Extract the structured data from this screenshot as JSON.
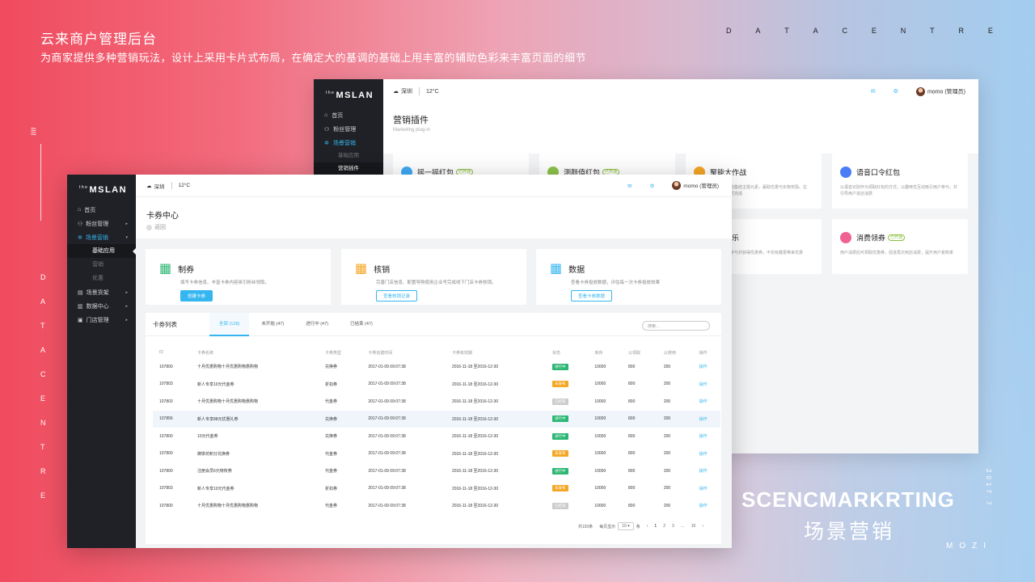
{
  "poster": {
    "title": "云来商户管理后台",
    "subtitle": "为商家提供多种营销玩法，设计上采用卡片式布局，在确定大的基调的基础上用丰富的辅助色彩来丰富页面的细节",
    "datacentre_letters": [
      "D",
      "A",
      "T",
      "A",
      "C",
      "E",
      "N",
      "T",
      "R",
      "E"
    ],
    "year": "2017.7",
    "big_en": "SCENCMARKRTING",
    "big_cn": "场景营销",
    "author": "MOZI"
  },
  "logo": {
    "prefix": "the",
    "name": "MSLAN"
  },
  "topbar": {
    "city": "深圳",
    "temp": "12°C",
    "user": "momo (管理员)"
  },
  "back_window": {
    "nav": [
      {
        "label": "首页",
        "icon": "home-icon"
      },
      {
        "label": "粉丝管理",
        "icon": "users-icon"
      },
      {
        "label": "场景营销",
        "icon": "scene-icon",
        "active": true
      }
    ],
    "subnav": [
      "基础应用",
      "营销插件"
    ],
    "header_title": "营销插件",
    "header_sub": "Marketing plug-in",
    "plugins": [
      {
        "name": "摇一摇红包",
        "tag": "已开通",
        "color": "#3fa9f5",
        "desc": ""
      },
      {
        "name": "测颜值红包",
        "tag": "已开通",
        "color": "#8bc34a",
        "desc": ""
      },
      {
        "name": "聚能大作战",
        "tag": "",
        "color": "#f5a623",
        "desc": "用户通过大富翁式游戏集结主题元素，赢取优惠与实物奖励。拉新、留存、转化一站式完成"
      },
      {
        "name": "语音口令红包",
        "tag": "",
        "color": "#4a7cf5",
        "desc": "以语音识别作为领取红包的方式，以趣味性互动吸引用户参与，并引导用户进店消费"
      },
      {
        "name": "",
        "tag": "",
        "color": "#ffffff",
        "desc": ""
      },
      {
        "name": "",
        "tag": "",
        "color": "#ffffff",
        "desc": ""
      },
      {
        "name": "运刮刮乐",
        "tag": "",
        "color": "#ffffff",
        "desc": "以刮奖的方式让用户参与并获得优惠券，不仅有趣更带来优惠"
      },
      {
        "name": "消费领券",
        "tag": "已开通",
        "color": "#f06292",
        "desc": "用户消费后可领取优惠券，促进再次到店消费，提升用户复购率"
      }
    ]
  },
  "front_window": {
    "nav": [
      {
        "label": "首页",
        "icon": "home-icon",
        "arrow": ""
      },
      {
        "label": "粉丝管理",
        "icon": "users-icon",
        "arrow": "▸"
      },
      {
        "label": "场景营销",
        "icon": "scene-icon",
        "arrow": "▾",
        "active": true
      }
    ],
    "subnav": [
      "基础应用",
      "营销",
      "优惠"
    ],
    "nav2": [
      {
        "label": "场景货架",
        "icon": "shelf-icon",
        "arrow": "▸"
      },
      {
        "label": "数据中心",
        "icon": "chart-icon",
        "arrow": "▸"
      },
      {
        "label": "门店管理",
        "icon": "store-icon",
        "arrow": "▸"
      }
    ],
    "header_title": "卡券中心",
    "back_label": "返回",
    "cards": [
      {
        "name": "制券",
        "desc": "填写卡券信息、丰富卡券内容吸引粉丝领取。",
        "btn": "创建卡券",
        "color": "#2bb673"
      },
      {
        "name": "核销",
        "desc": "完善门店信息、配置导购使用企业号完成线下门店卡券核销。",
        "btn": "查看核销记录",
        "color": "#f5a623"
      },
      {
        "name": "数据",
        "desc": "查看卡券投放数据，评估每一次卡券投放效果",
        "btn": "查看卡券数据",
        "color": "#35b6f0"
      }
    ],
    "list_title": "卡券列表",
    "tabs": [
      "全部 (128)",
      "未开始 (47)",
      "进行中 (47)",
      "已结束 (47)"
    ],
    "search_placeholder": "搜索...",
    "columns": [
      "ID",
      "卡券名称",
      "卡券类型",
      "卡券创建时间",
      "卡券有效期",
      "状态",
      "库存",
      "以领取",
      "以使用",
      "操作"
    ],
    "rows": [
      [
        "107800",
        "十月优惠购物十月优惠购物惠购物",
        "兑换券",
        "2017-01-09 09:07:38",
        "2016-11-18 至2016-12-30",
        "进行中",
        "10000",
        "800",
        "200",
        "操作"
      ],
      [
        "107803",
        "新人专享10元代金券",
        "折扣券",
        "2017-01-09 09:07:38",
        "2016-11-18 至2016-12-30",
        "未发布",
        "10000",
        "800",
        "200",
        "操作"
      ],
      [
        "107803",
        "十月优惠购物十月优惠购物惠购物",
        "代金券",
        "2017-01-09 09:07:38",
        "2016-11-18 至2016-12-30",
        "已结束",
        "10000",
        "800",
        "200",
        "操作"
      ],
      [
        "107856",
        "新人专享88元优惠礼券",
        "兑换券",
        "2017-01-09 09:07:38",
        "2016-11-18 至2016-12-30",
        "进行中",
        "10000",
        "800",
        "200",
        "操作"
      ],
      [
        "107800",
        "10元代金券",
        "兑换券",
        "2017-01-09 09:07:38",
        "2016-11-18 至2016-12-30",
        "进行中",
        "10000",
        "800",
        "200",
        "操作"
      ],
      [
        "107800",
        "御饼坊积分兑换券",
        "代金券",
        "2017-01-09 09:07:38",
        "2016-11-18 至2016-12-30",
        "未发布",
        "10000",
        "800",
        "200",
        "操作"
      ],
      [
        "107800",
        "注册会员6元特权券",
        "代金券",
        "2017-01-09 09:07:38",
        "2016-11-18 至2016-12-30",
        "进行中",
        "10000",
        "800",
        "200",
        "操作"
      ],
      [
        "107803",
        "新人专享10元代金券",
        "折扣券",
        "2017-01-09 09:07:38",
        "2016-11-18 至2016-12-30",
        "未发布",
        "10000",
        "800",
        "200",
        "操作"
      ],
      [
        "107800",
        "十月优惠购物十月优惠购物惠购物",
        "代金券",
        "2017-01-09 09:07:38",
        "2016-11-18 至2016-12-30",
        "已结束",
        "10000",
        "800",
        "200",
        "操作"
      ]
    ],
    "status_colors": {
      "进行中": "#2bb673",
      "未发布": "#f5a623",
      "已结束": "#cccccc"
    },
    "pager": {
      "total": "共150条",
      "per_label": "每页显示",
      "per_value": "10 ▾",
      "unit": "条",
      "prev": "‹",
      "pages": [
        "1",
        "2",
        "3",
        "…",
        "15"
      ],
      "next": "›"
    }
  }
}
